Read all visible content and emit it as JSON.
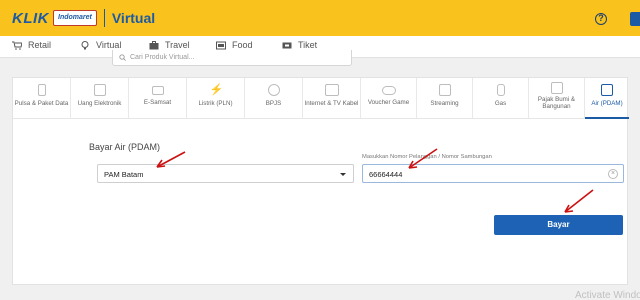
{
  "header": {
    "logo_klik": "KLIK",
    "logo_badge": "Indomaret",
    "section": "Virtual",
    "help_icon": "question-circle-icon"
  },
  "categories": [
    {
      "label": "Retail",
      "icon": "cart-icon"
    },
    {
      "label": "Virtual",
      "icon": "bulb-icon"
    },
    {
      "label": "Travel",
      "icon": "suitcase-icon"
    },
    {
      "label": "Food",
      "icon": "food-icon"
    },
    {
      "label": "Tiket",
      "icon": "ticket-icon"
    }
  ],
  "search": {
    "placeholder": "Cari Produk Virtual..."
  },
  "tabs": [
    {
      "label": "Pulsa & Paket Data"
    },
    {
      "label": "Uang Elektronik"
    },
    {
      "label": "E-Samsat"
    },
    {
      "label": "Listrik (PLN)"
    },
    {
      "label": "BPJS"
    },
    {
      "label": "Internet & TV Kabel"
    },
    {
      "label": "Voucher Game"
    },
    {
      "label": "Streaming"
    },
    {
      "label": "Gas"
    },
    {
      "label": "Pajak Bumi & Bangunan"
    },
    {
      "label": "Air (PDAM)"
    }
  ],
  "form": {
    "title": "Bayar Air (PDAM)",
    "region_value": "PAM Batam",
    "customer_label": "Masukkan Nomor Pelanggan / Nomor Sambungan",
    "customer_value": "66664444",
    "submit_label": "Bayar"
  },
  "colors": {
    "header": "#f9c21c",
    "primary": "#1d62b4",
    "annotation": "#cc1111"
  },
  "watermark": "Activate Windows"
}
